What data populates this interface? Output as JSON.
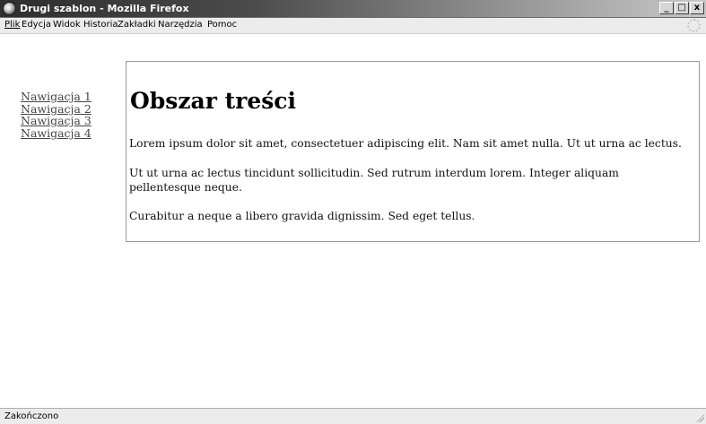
{
  "window": {
    "title": "Drugi szablon - Mozilla Firefox",
    "controls": {
      "minimize": "_",
      "maximize": "□",
      "close": "x"
    }
  },
  "menu": {
    "items": [
      "Plik",
      "Edycja",
      "Widok",
      "Historia",
      "Zakładki",
      "Narzędzia",
      "Pomoc"
    ]
  },
  "nav": {
    "links": [
      "Nawigacja 1",
      "Nawigacja 2",
      "Nawigacja 3",
      "Nawigacja 4"
    ]
  },
  "content": {
    "title": "Obszar treści",
    "paragraphs": [
      "Lorem ipsum dolor sit amet, consectetuer adipiscing elit. Nam sit amet nulla. Ut ut urna ac lectus.",
      "Ut ut urna ac lectus tincidunt sollicitudin. Sed rutrum interdum lorem. Integer aliquam pellentesque neque.",
      "Curabitur a neque a libero gravida dignissim. Sed eget tellus."
    ]
  },
  "status": {
    "text": "Zakończono"
  },
  "icons": {
    "app": "firefox-icon",
    "throbber": "throbber-icon",
    "grip": "resize-grip-icon"
  }
}
